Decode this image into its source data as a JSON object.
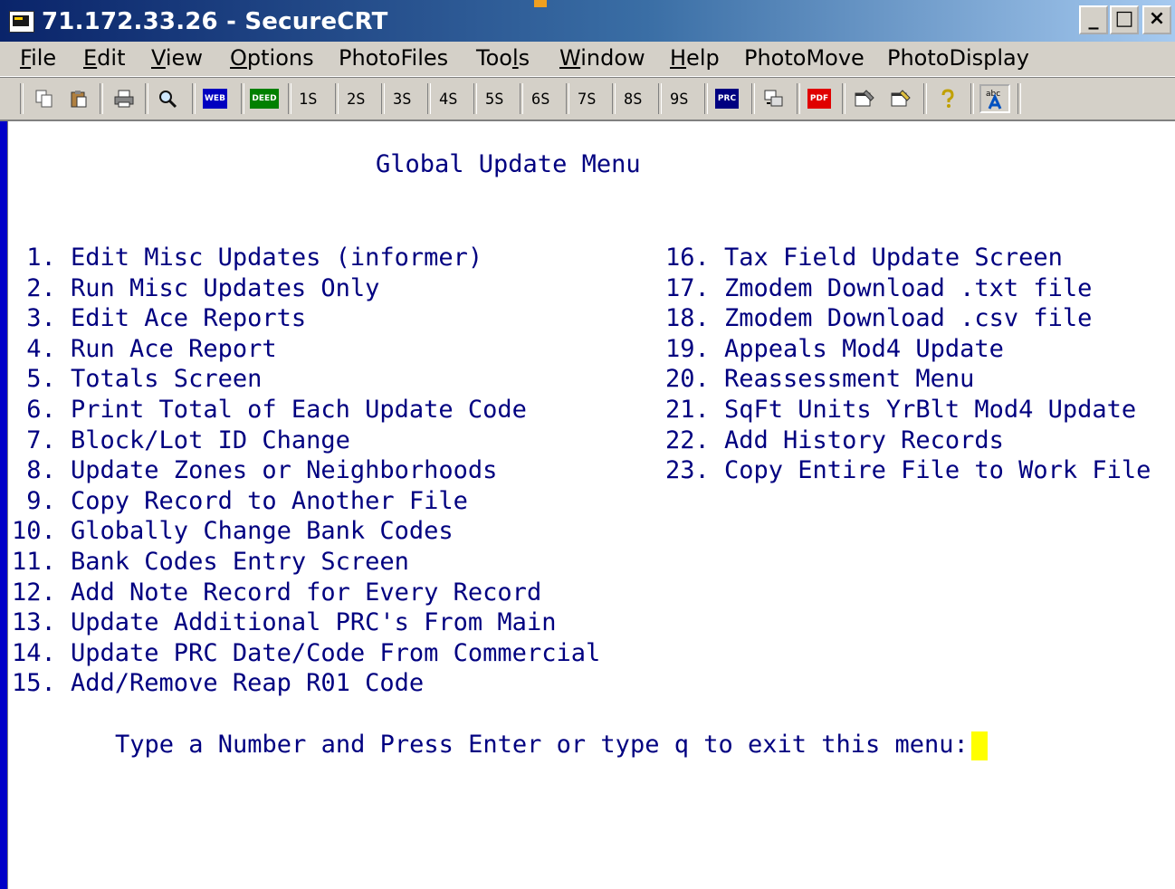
{
  "window": {
    "title": "71.172.33.26 - SecureCRT",
    "controls": [
      "_",
      "□",
      "×"
    ]
  },
  "menubar": {
    "items": [
      {
        "pre": "",
        "ul": "F",
        "post": "ile"
      },
      {
        "pre": "",
        "ul": "E",
        "post": "dit"
      },
      {
        "pre": "",
        "ul": "V",
        "post": "iew"
      },
      {
        "pre": "",
        "ul": "O",
        "post": "ptions"
      },
      {
        "pre": "PhotoFiles",
        "ul": "",
        "post": ""
      },
      {
        "pre": "Too",
        "ul": "l",
        "post": "s"
      },
      {
        "pre": "",
        "ul": "W",
        "post": "indow"
      },
      {
        "pre": "",
        "ul": "H",
        "post": "elp"
      },
      {
        "pre": "PhotoMove",
        "ul": "",
        "post": ""
      },
      {
        "pre": "PhotoDisplay",
        "ul": "",
        "post": ""
      }
    ]
  },
  "toolbar": {
    "icons": [
      "copy-icon",
      "paste-icon",
      "print-icon",
      "find-icon",
      "web-icon",
      "deed-icon",
      "prc-icon",
      "transfer-icon",
      "pdf-icon",
      "properties-icon",
      "session-options-icon",
      "help-icon",
      "font-icon"
    ],
    "tags": {
      "web": "WEB",
      "deed": "DEED",
      "prc": "PRC",
      "pdf": "PDF",
      "abc": "abc"
    },
    "screen_buttons": [
      "1S",
      "2S",
      "3S",
      "4S",
      "5S",
      "6S",
      "7S",
      "8S",
      "9S"
    ],
    "colors": {
      "web": "#0000c0",
      "deed": "#008000",
      "prc": "#000080",
      "pdf": "#e00000"
    }
  },
  "terminal": {
    "heading": "Global Update Menu",
    "left_items": [
      " 1. Edit Misc Updates (informer)",
      " 2. Run Misc Updates Only",
      " 3. Edit Ace Reports",
      " 4. Run Ace Report",
      " 5. Totals Screen",
      " 6. Print Total of Each Update Code",
      " 7. Block/Lot ID Change",
      " 8. Update Zones or Neighborhoods",
      " 9. Copy Record to Another File",
      "10. Globally Change Bank Codes",
      "11. Bank Codes Entry Screen",
      "12. Add Note Record for Every Record",
      "13. Update Additional PRC's From Main",
      "14. Update PRC Date/Code From Commercial",
      "15. Add/Remove Reap R01 Code"
    ],
    "right_items": [
      "16. Tax Field Update Screen",
      "17. Zmodem Download .txt file",
      "18. Zmodem Download .csv file",
      "19. Appeals Mod4 Update",
      "20. Reassessment Menu",
      "21. SqFt Units YrBlt Mod4 Update",
      "22. Add History Records",
      "23. Copy Entire File to Work File"
    ],
    "prompt": "Type a Number and Press Enter or type q to exit this menu:",
    "text_color": "#000080",
    "cursor_color": "#ffff00"
  }
}
